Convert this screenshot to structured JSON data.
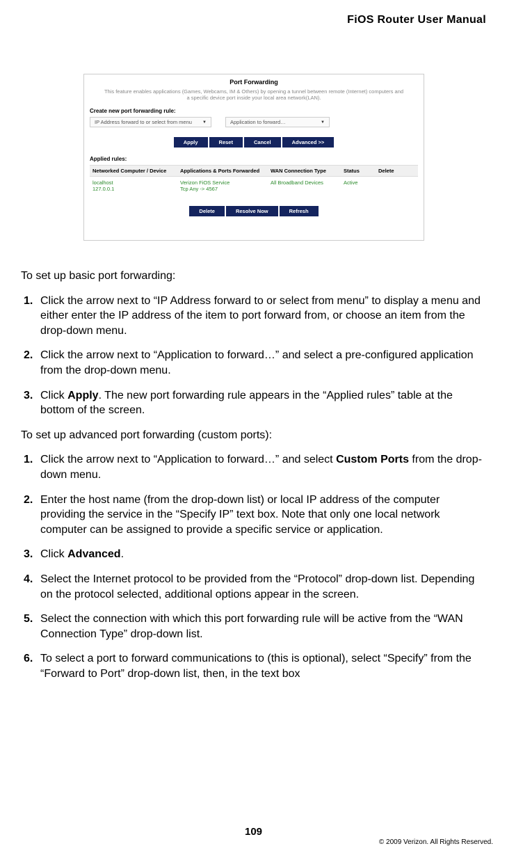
{
  "header": {
    "title": "FiOS Router User Manual"
  },
  "screenshot": {
    "title": "Port Forwarding",
    "desc": "This feature enables applications (Games, Webcams, IM & Others) by opening a tunnel between remote (Internet) computers and a specific device port inside your local area network(LAN).",
    "create_label": "Create new port forwarding rule:",
    "dd1": "IP Address forward to or select from menu",
    "dd2": "Application to forward…",
    "btns1": [
      "Apply",
      "Reset",
      "Cancel",
      "Advanced >>"
    ],
    "applied_label": "Applied rules:",
    "th": [
      "Networked Computer / Device",
      "Applications & Ports Forwarded",
      "WAN Connection Type",
      "Status",
      "Delete"
    ],
    "row": {
      "host": "localhost",
      "ip": "127.0.0.1",
      "app1": "Verizon FiOS Service",
      "app2": "Tcp Any -> 4567",
      "wan": "All Broadband Devices",
      "status": "Active"
    },
    "btns2": [
      "Delete",
      "Resolve Now",
      "Refresh"
    ]
  },
  "body": {
    "intro1": "To set up basic port forwarding:",
    "basic": [
      "Click the arrow next to “IP Address forward to or select from menu” to display  a menu and either enter the IP address of the item to port forward from, or choose an item from the drop-down menu.",
      "Click the arrow next to “Application to forward…” and select a pre-configured application from the drop-down menu."
    ],
    "basic3_pre": "Click ",
    "basic3_bold": "Apply",
    "basic3_post": ". The new port forwarding rule appears in the “Applied rules” table at the bottom of the screen.",
    "intro2": "To set up advanced port forwarding (custom ports):",
    "adv1_pre": "Click the arrow next to “Application to forward…” and select ",
    "adv1_bold": "Custom Ports",
    "adv1_post": " from the drop-down menu.",
    "adv2": "Enter the host name (from the drop-down list) or local IP address of the computer providing the service in the “Specify IP” text box. Note that only one local network computer can be assigned to provide a specific service or application.",
    "adv3_pre": "Click ",
    "adv3_bold": "Advanced",
    "adv3_post": ".",
    "adv4": "Select the Internet protocol to be provided from the “Protocol” drop-down list.  Depending on the protocol selected, additional options appear in the screen.",
    "adv5": "Select the connection with which this port forwarding rule will be active from the “WAN Connection Type” drop-down list.",
    "adv6": "To select a port to forward communications to (this is optional), select “Specify” from the “Forward to Port” drop-down list, then, in the text box"
  },
  "footer": {
    "page": "109",
    "copyright": "© 2009 Verizon. All Rights Reserved."
  }
}
